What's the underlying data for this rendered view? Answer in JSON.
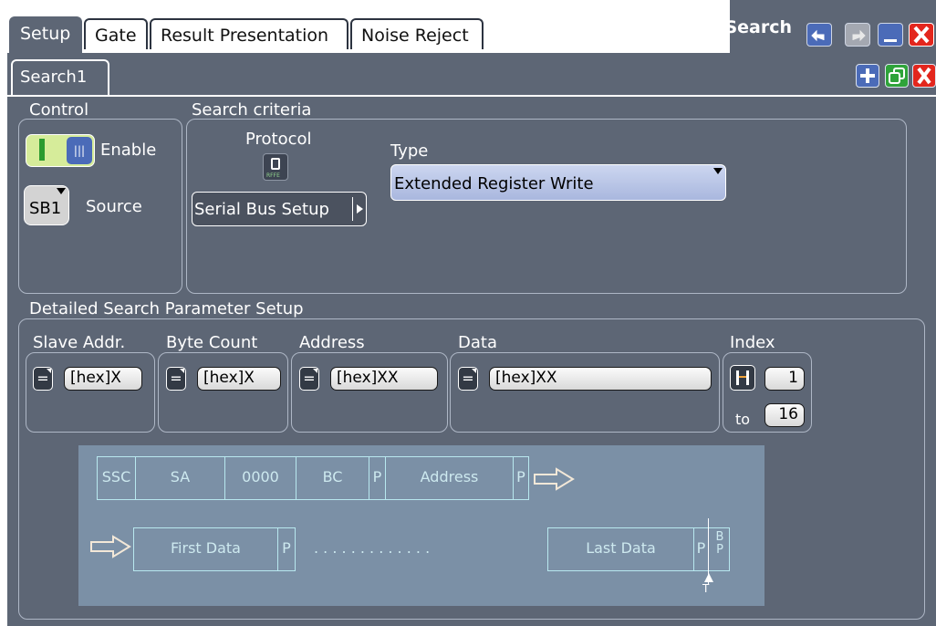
{
  "tabs": [
    "Setup",
    "Gate",
    "Result Presentation",
    "Noise Reject"
  ],
  "window": {
    "title": "Search"
  },
  "subtab": {
    "label": "Search1"
  },
  "control": {
    "title": "Control",
    "toggle_on": "I",
    "toggle_off": "|||",
    "enable_label": "Enable",
    "source_value": "SB1",
    "source_label": "Source"
  },
  "criteria": {
    "title": "Search criteria",
    "protocol_label": "Protocol",
    "protocol_icon_text": "RFFE",
    "serial_bus_button": "Serial Bus Setup",
    "type_label": "Type",
    "type_value": "Extended Register Write"
  },
  "detail": {
    "title": "Detailed Search Parameter Setup",
    "params": [
      {
        "label": "Slave Addr.",
        "op": "=",
        "value": "[hex]X"
      },
      {
        "label": "Byte Count",
        "op": "=",
        "value": "[hex]X"
      },
      {
        "label": "Address",
        "op": "=",
        "value": "[hex]XX"
      },
      {
        "label": "Data",
        "op": "=",
        "value": "[hex]XX"
      }
    ],
    "index": {
      "label": "Index",
      "from": "1",
      "to_label": "to",
      "to": "16"
    }
  },
  "diagram": {
    "row1": [
      "SSC",
      "SA",
      "0000",
      "BC",
      "P",
      "Address",
      "P"
    ],
    "row2_first": "First Data",
    "row2_p": "P",
    "row2_dots": ". . . . . . . . . . . . .",
    "row2_last": "Last Data",
    "row2_p2": "P",
    "bp_b": "B",
    "bp_p": "P",
    "marker": "T"
  },
  "colors": {
    "accent": "#5d6675",
    "diagram_bg": "#7b90a6",
    "diagram_line": "#b8e8ef",
    "type_field": "#b8c6e8"
  }
}
